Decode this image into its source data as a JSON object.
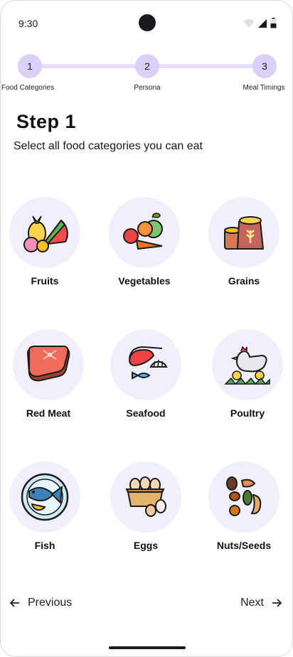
{
  "status_bar": {
    "time": "9:30"
  },
  "stepper": {
    "steps": [
      {
        "number": "1",
        "label": "Food Categories"
      },
      {
        "number": "2",
        "label": "Persona"
      },
      {
        "number": "3",
        "label": "Meal Timings"
      }
    ]
  },
  "heading": {
    "title": "Step 1",
    "subtitle": "Select all food categories you can eat"
  },
  "categories": [
    {
      "label": "Fruits",
      "icon": "fruits-icon"
    },
    {
      "label": "Vegetables",
      "icon": "vegetables-icon"
    },
    {
      "label": "Grains",
      "icon": "grains-icon"
    },
    {
      "label": "Red Meat",
      "icon": "red-meat-icon"
    },
    {
      "label": "Seafood",
      "icon": "seafood-icon"
    },
    {
      "label": "Poultry",
      "icon": "poultry-icon"
    },
    {
      "label": "Fish",
      "icon": "fish-icon"
    },
    {
      "label": "Eggs",
      "icon": "eggs-icon"
    },
    {
      "label": "Nuts/Seeds",
      "icon": "nuts-seeds-icon"
    }
  ],
  "navigation": {
    "previous_label": "Previous",
    "next_label": "Next"
  },
  "colors": {
    "step_circle": "#dcd0fb",
    "step_line": "#e6defa",
    "category_bg": "#f2effd"
  }
}
